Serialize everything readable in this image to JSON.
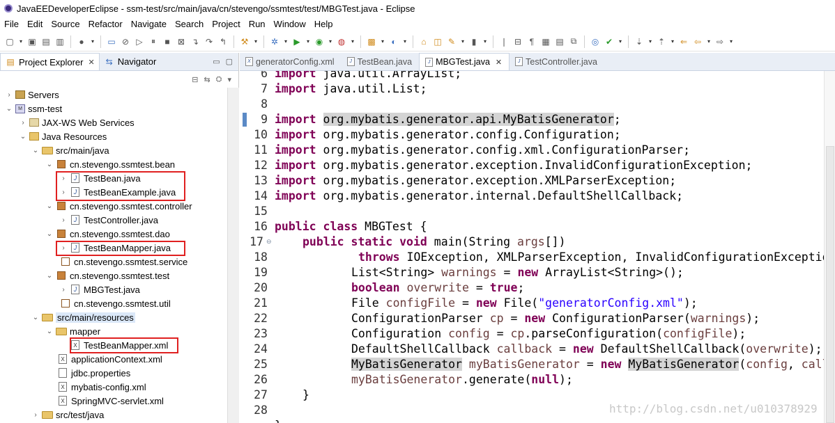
{
  "window": {
    "title": "JavaEEDeveloperEclipse - ssm-test/src/main/java/cn/stevengo/ssmtest/test/MBGTest.java - Eclipse"
  },
  "menu": [
    "File",
    "Edit",
    "Source",
    "Refactor",
    "Navigate",
    "Search",
    "Project",
    "Run",
    "Window",
    "Help"
  ],
  "left_panel": {
    "tabs": [
      {
        "label": "Project Explorer",
        "close": "✕"
      },
      {
        "label": "Navigator"
      }
    ],
    "tree": [
      {
        "label": "Servers"
      },
      {
        "label": "ssm-test"
      },
      {
        "label": "JAX-WS Web Services"
      },
      {
        "label": "Java Resources"
      },
      {
        "label": "src/main/java"
      },
      {
        "label": "cn.stevengo.ssmtest.bean"
      },
      {
        "label": "TestBean.java"
      },
      {
        "label": "TestBeanExample.java"
      },
      {
        "label": "cn.stevengo.ssmtest.controller"
      },
      {
        "label": "TestController.java"
      },
      {
        "label": "cn.stevengo.ssmtest.dao"
      },
      {
        "label": "TestBeanMapper.java"
      },
      {
        "label": "cn.stevengo.ssmtest.service"
      },
      {
        "label": "cn.stevengo.ssmtest.test"
      },
      {
        "label": "MBGTest.java"
      },
      {
        "label": "cn.stevengo.ssmtest.util"
      },
      {
        "label": "src/main/resources"
      },
      {
        "label": "mapper"
      },
      {
        "label": "TestBeanMapper.xml"
      },
      {
        "label": "applicationContext.xml"
      },
      {
        "label": "jdbc.properties"
      },
      {
        "label": "mybatis-config.xml"
      },
      {
        "label": "SpringMVC-servlet.xml"
      },
      {
        "label": "src/test/java"
      }
    ]
  },
  "editor": {
    "tabs": [
      {
        "label": "generatorConfig.xml"
      },
      {
        "label": "TestBean.java"
      },
      {
        "label": "MBGTest.java",
        "close": "✕"
      },
      {
        "label": "TestController.java"
      }
    ],
    "line_numbers": [
      "6",
      "7",
      "8",
      "9",
      "10",
      "11",
      "12",
      "13",
      "14",
      "15",
      "16",
      "17",
      "18",
      "19",
      "20",
      "21",
      "22",
      "23",
      "24",
      "25",
      "26",
      "27",
      "28"
    ],
    "watermark": "http://blog.csdn.net/u010378929"
  },
  "colors": {
    "keyword": "#7f0055",
    "string": "#2a00ff",
    "local_var": "#6a3e3e",
    "highlight_box": "#e02020"
  }
}
